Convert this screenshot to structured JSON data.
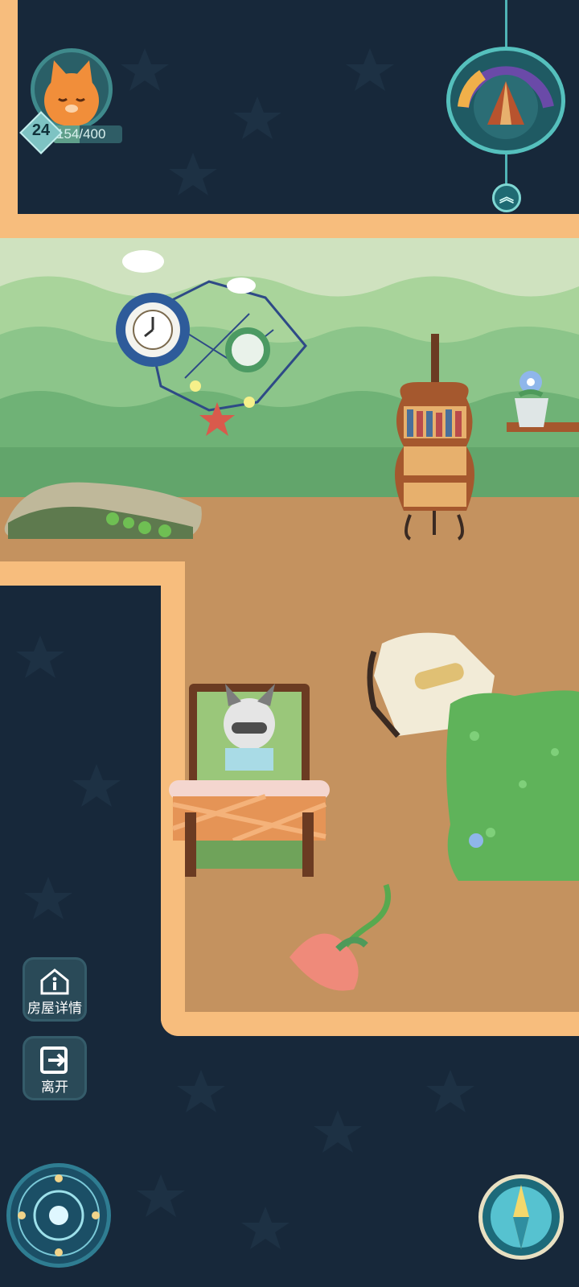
{
  "player": {
    "level": "24",
    "xp_text": "154/400",
    "xp_progress": 0.385
  },
  "side_buttons": {
    "house_details_label": "房屋详情",
    "leave_label": "离开"
  },
  "colors": {
    "background": "#17283a",
    "wall_trim": "#f7bd7d",
    "floor": "#c4925f",
    "accent_teal": "#55c0bd"
  },
  "icons": {
    "avatar": "orange-cat-avatar",
    "time_dial": "day-night-dial-icon",
    "expand": "chevron-up-double-icon",
    "house_info": "house-info-icon",
    "exit": "exit-door-icon",
    "magic_circle": "magic-circle-icon",
    "compass": "compass-icon"
  }
}
